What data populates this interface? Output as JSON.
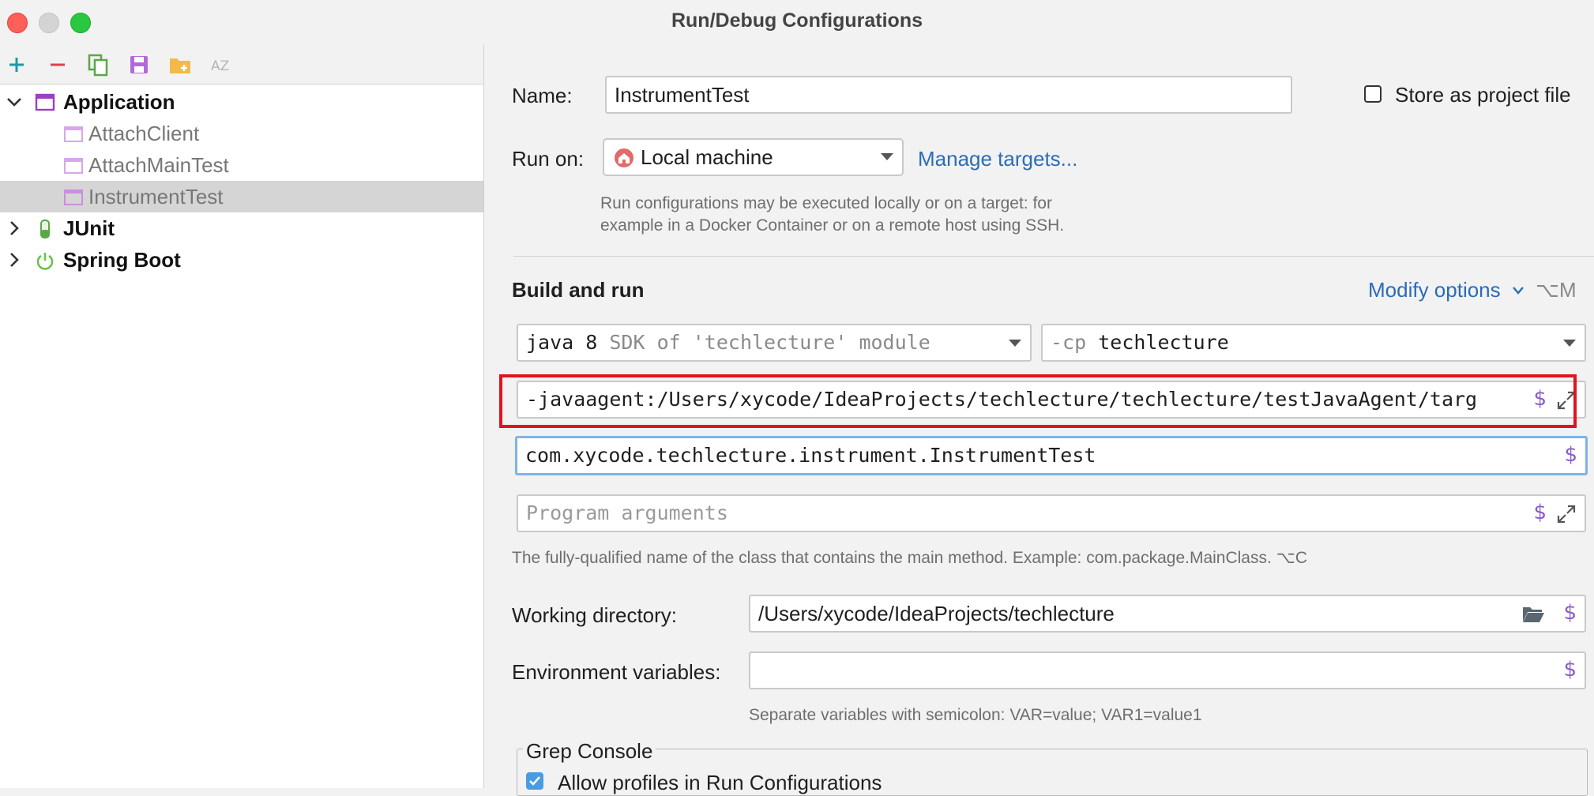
{
  "window": {
    "title": "Run/Debug Configurations"
  },
  "toolbar": {
    "icons": [
      "plus-icon",
      "minus-icon",
      "copy-icon",
      "save-icon",
      "folder-add-icon",
      "sort-az-icon"
    ],
    "sort_label": "AZ"
  },
  "tree": {
    "application": "Application",
    "children": [
      "AttachClient",
      "AttachMainTest",
      "InstrumentTest"
    ],
    "junit": "JUnit",
    "spring": "Spring Boot"
  },
  "form": {
    "name_label": "Name:",
    "name_value": "InstrumentTest",
    "store_label": "Store as project file",
    "store_checked": false,
    "run_on_label": "Run on:",
    "run_on_value": "Local machine",
    "manage_targets": "Manage targets...",
    "run_hint_1": "Run configurations may be executed locally or on a target: for",
    "run_hint_2": "example in a Docker Container or on a remote host using SSH.",
    "build_run": "Build and run",
    "modify_options": "Modify options",
    "modify_shortcut": "⌥M",
    "jdk_main": "java 8",
    "jdk_sub": "SDK of 'techlecture' module",
    "cp_prefix": "-cp",
    "cp_value": "techlecture",
    "vm_options": "-javaagent:/Users/xycode/IdeaProjects/techlecture/techlecture/testJavaAgent/targ",
    "main_class": "com.xycode.techlecture.instrument.InstrumentTest",
    "program_args_placeholder": "Program arguments",
    "main_class_hint": "The fully-qualified name of the class that contains the main method. Example: com.package.MainClass. ⌥C",
    "workdir_label": "Working directory:",
    "workdir_value": "/Users/xycode/IdeaProjects/techlecture",
    "env_label": "Environment variables:",
    "env_value": "",
    "env_hint": "Separate variables with semicolon: VAR=value; VAR1=value1",
    "grep_title": "Grep Console",
    "grep_allow": "Allow profiles in Run Configurations",
    "grep_checked": true,
    "dollar": "$"
  },
  "colors": {
    "highlight_box": "#e0141e",
    "link": "#2b6cb8",
    "dollar": "#8b5cc9",
    "selection": "#d5d5d5"
  }
}
